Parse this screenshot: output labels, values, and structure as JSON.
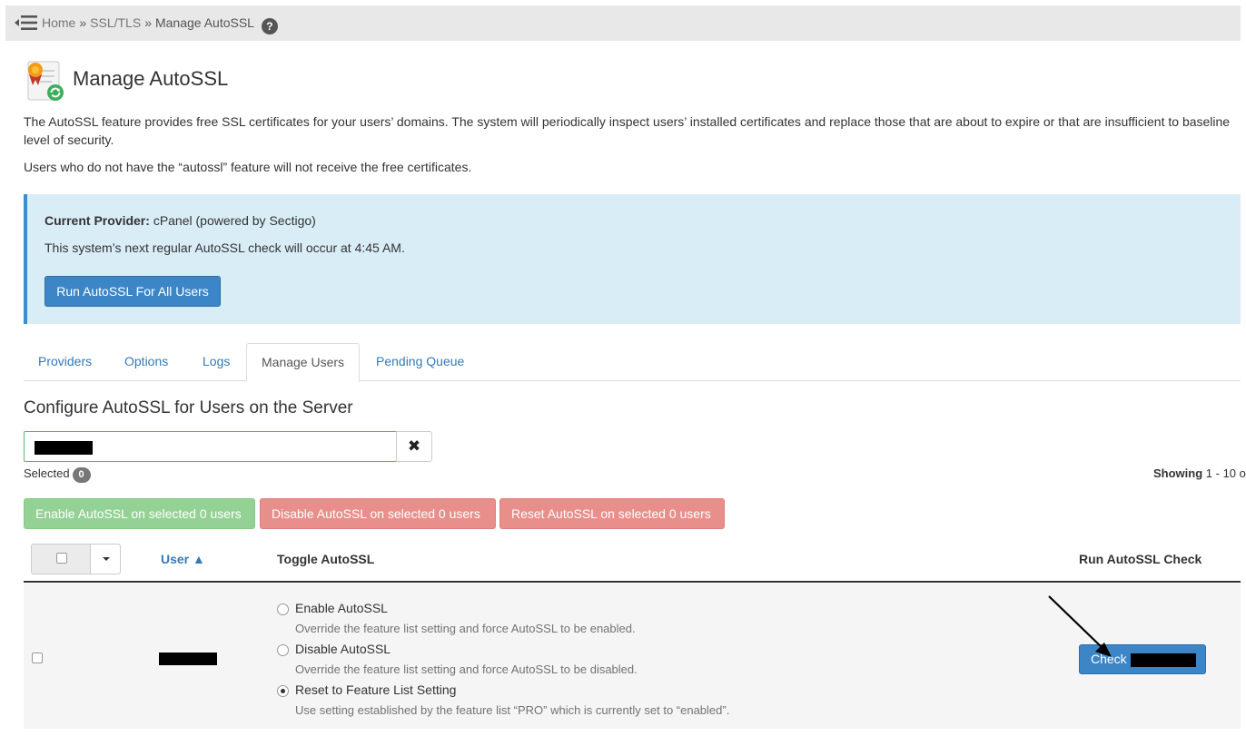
{
  "breadcrumb": {
    "home": "Home",
    "separator": "»",
    "section": "SSL/TLS",
    "current": "Manage AutoSSL",
    "help_glyph": "?"
  },
  "page": {
    "title": "Manage AutoSSL",
    "description": "The AutoSSL feature provides free SSL certificates for your users’ domains. The system will periodically inspect users’ installed certificates and replace those that are about to expire or that are insufficient to baseline level of security.",
    "note": "Users who do not have the “autossl” feature will not receive the free certificates."
  },
  "provider_box": {
    "provider_label": "Current Provider:",
    "provider_value": "cPanel (powered by Sectigo)",
    "next_check": "This system’s next regular AutoSSL check will occur at 4:45 AM.",
    "run_all_button": "Run AutoSSL For All Users"
  },
  "tabs": [
    {
      "label": "Providers",
      "active": false
    },
    {
      "label": "Options",
      "active": false
    },
    {
      "label": "Logs",
      "active": false
    },
    {
      "label": "Manage Users",
      "active": true
    },
    {
      "label": "Pending Queue",
      "active": false
    }
  ],
  "users_section": {
    "heading": "Configure AutoSSL for Users on the Server",
    "search_value": "",
    "clear_glyph": "✖",
    "selected_label": "Selected",
    "selected_count": "0",
    "showing_label": "Showing",
    "showing_range": "1 - 10 o",
    "enable_selected": "Enable AutoSSL on selected 0 users",
    "disable_selected": "Disable AutoSSL on selected 0 users",
    "reset_selected": "Reset AutoSSL on selected 0 users"
  },
  "table": {
    "col_user": "User ▲",
    "col_toggle": "Toggle AutoSSL",
    "col_run": "Run AutoSSL Check",
    "rows": [
      {
        "options": [
          {
            "label": "Enable AutoSSL",
            "help": "Override the feature list setting and force AutoSSL to be enabled.",
            "checked": false
          },
          {
            "label": "Disable AutoSSL",
            "help": "Override the feature list setting and force AutoSSL to be disabled.",
            "checked": false
          },
          {
            "label": "Reset to Feature List Setting",
            "help": "Use setting established by the feature list “PRO” which is currently set to “enabled”.",
            "checked": true
          }
        ],
        "check_button": "Check"
      }
    ]
  },
  "colors": {
    "primary": "#3c86c8",
    "info_bg": "#d9edf7",
    "success_light": "#94d195",
    "danger_light": "#e88e8b",
    "link": "#337ab7"
  },
  "icons": [
    "menu-collapse-icon",
    "help-icon",
    "autossl-certificate-icon",
    "clear-icon",
    "chevron-down-icon",
    "annotation-arrow"
  ]
}
